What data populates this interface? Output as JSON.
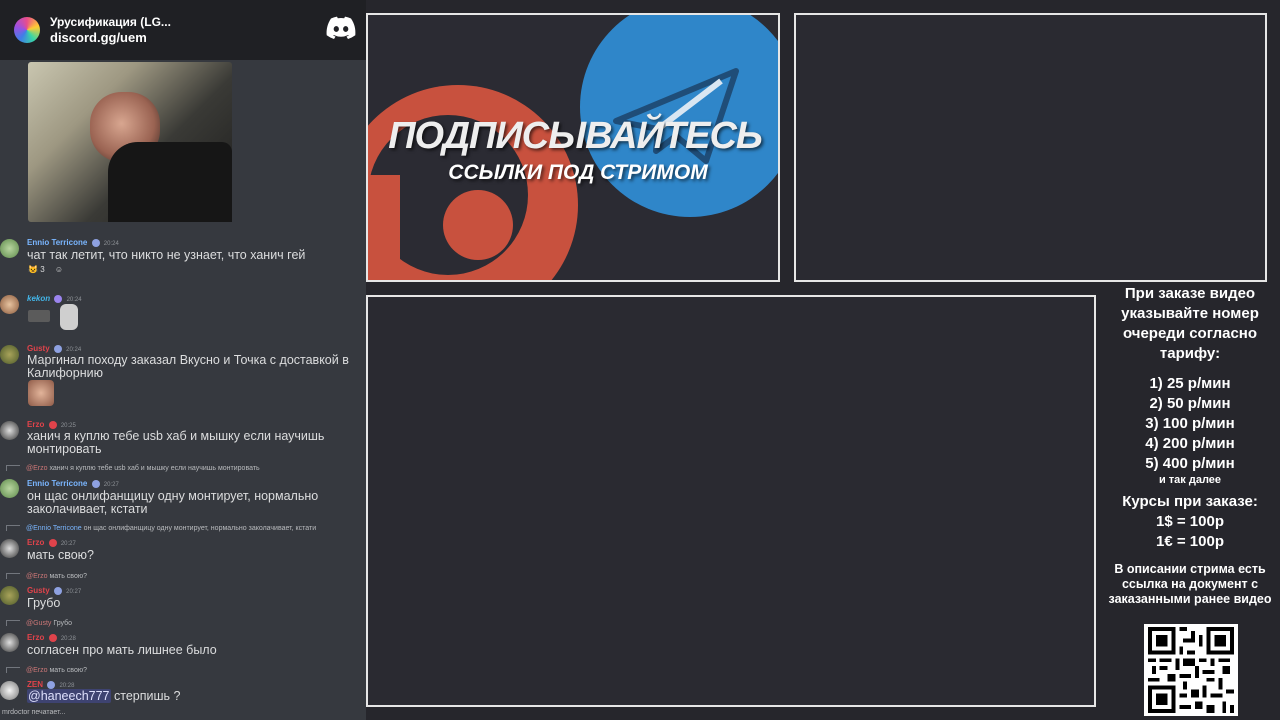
{
  "discord": {
    "server_name": "Урусификация (LG...",
    "invite": "discord.gg/uem",
    "logo_icon": "discord-logo-icon",
    "messages": [
      {
        "author": "Ennio Terricone",
        "author_color": "#7ab6ff",
        "time": "20:24",
        "text": "чат так летит, что никто не узнает, что ханич гей",
        "reaction_count": "3"
      },
      {
        "author": "kekon",
        "author_color": "#43b5e8",
        "time": "20:24",
        "text": ""
      },
      {
        "author": "Gusty",
        "author_color": "#e0434b",
        "time": "20:24",
        "text": "Маргинал походу заказал Вкусно и Точка с доставкой в Калифорнию"
      },
      {
        "author": "Erzo",
        "author_color": "#e0434b",
        "time": "20:25",
        "text": "ханич я куплю тебе usb хаб и мышку если научишь монтировать"
      },
      {
        "reply_author": "@Erzo",
        "reply_text": "ханич я куплю тебе usb хаб и мышку если научишь монтировать",
        "author": "Ennio Terricone",
        "author_color": "#7ab6ff",
        "time": "20:27",
        "text": "он щас онлифанщицу одну монтирует, нормально заколачивает, кстати"
      },
      {
        "reply_author": "@Ennio Terricone",
        "reply_text": "он щас онлифанщицу одну монтирует, нормально заколачивает, кстати",
        "author": "Erzo",
        "author_color": "#e0434b",
        "time": "20:27",
        "text": "мать свою?"
      },
      {
        "reply_author": "@Erzo",
        "reply_text": "мать свою?",
        "author": "Gusty",
        "author_color": "#e0434b",
        "time": "20:27",
        "text": "Грубо"
      },
      {
        "reply_author": "@Gusty",
        "reply_text": "Грубо",
        "author": "Erzo",
        "author_color": "#e0434b",
        "time": "20:28",
        "text": "согласен про мать лишнее было"
      },
      {
        "reply_author": "@Erzo",
        "reply_text": "мать свою?",
        "author": "ZEN",
        "author_color": "#e0434b",
        "time": "20:28",
        "mention": "@haneech777",
        "text": "стерпишь ?"
      }
    ],
    "typing": "mrdoctor печатает..."
  },
  "banner": {
    "title": "ПОДПИСЫВАЙТЕСЬ",
    "subtitle": "ССЫЛКИ ПОД СТРИМОМ",
    "icons": [
      "patreon-logo-icon",
      "telegram-logo-icon"
    ]
  },
  "info": {
    "order_note": "При заказе видео указывайте номер очереди согласно тарифу:",
    "tariffs": [
      "1) 25 р/мин",
      "2) 50 р/мин",
      "3) 100 р/мин",
      "4) 200 р/мин",
      "5) 400 р/мин"
    ],
    "etc": "и так далее",
    "rates_title": "Курсы при заказе:",
    "rates": [
      "1$ = 100р",
      "1€ = 100р"
    ],
    "doc_note": "В описании стрима есть ссылка на документ с заказанными ранее видео",
    "qr_icon": "qr-code-icon"
  },
  "colors": {
    "telegram": "#2f86c9",
    "patreon": "#c8513e",
    "panel_border": "#e6e6e6",
    "chat_bg": "#36393f"
  }
}
